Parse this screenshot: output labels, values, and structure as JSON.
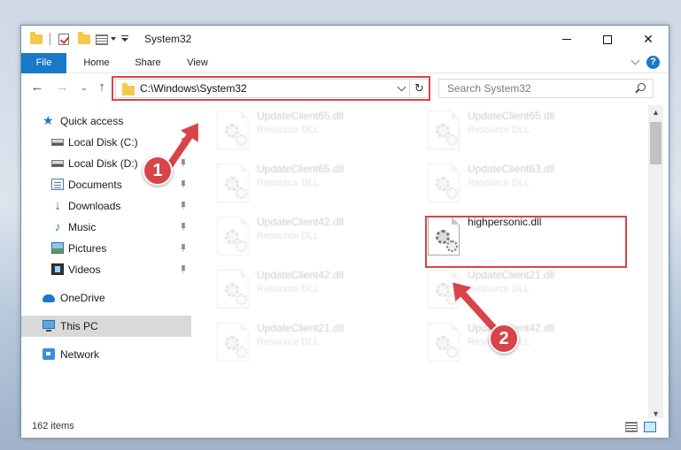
{
  "window": {
    "title": "System32"
  },
  "ribbon": {
    "tabs": [
      "File",
      "Home",
      "Share",
      "View"
    ],
    "help": "?"
  },
  "address": {
    "path": "C:\\Windows\\System32",
    "search_placeholder": "Search System32"
  },
  "nav": {
    "items": [
      {
        "label": "Quick access",
        "icon": "star-icon"
      },
      {
        "label": "Local Disk (C:)",
        "icon": "drive-icon",
        "pinned": true
      },
      {
        "label": "Local Disk (D:)",
        "icon": "drive-icon",
        "pinned": true
      },
      {
        "label": "Documents",
        "icon": "documents-icon",
        "pinned": true
      },
      {
        "label": "Downloads",
        "icon": "download-icon",
        "pinned": true
      },
      {
        "label": "Music",
        "icon": "music-icon",
        "pinned": true
      },
      {
        "label": "Pictures",
        "icon": "pictures-icon",
        "pinned": true
      },
      {
        "label": "Videos",
        "icon": "videos-icon",
        "pinned": true
      },
      {
        "label": "OneDrive",
        "icon": "onedrive-icon"
      },
      {
        "label": "This PC",
        "icon": "computer-icon",
        "selected": true
      },
      {
        "label": "Network",
        "icon": "network-icon"
      }
    ]
  },
  "files": [
    {
      "name": "UpdateClient65.dll",
      "type": "Resource DLL"
    },
    {
      "name": "UpdateClient65.dll",
      "type": "Resource DLL"
    },
    {
      "name": "UpdateClient65.dll",
      "type": "Resource DLL"
    },
    {
      "name": "UpdateClient63.dll",
      "type": "Resource DLL"
    },
    {
      "name": "UpdateClient42.dll",
      "type": "Resource DLL"
    },
    {
      "name": "highpersonic.dll",
      "type": ""
    },
    {
      "name": "UpdateClient42.dll",
      "type": "Resource DLL"
    },
    {
      "name": "UpdateClient21.dll",
      "type": "Resource DLL"
    },
    {
      "name": "UpdateClient21.dll",
      "type": "Resource DLL"
    },
    {
      "name": "UpdateClient42.dll",
      "type": "Resource DLL"
    }
  ],
  "status": {
    "item_count": "162 items"
  },
  "annotations": {
    "step1": "1",
    "step2": "2",
    "color": "#d9434a"
  }
}
